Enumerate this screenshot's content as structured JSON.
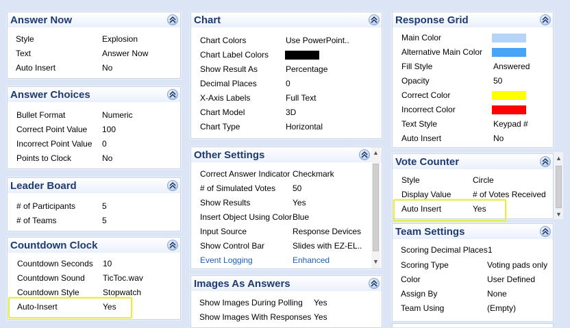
{
  "answer_now": {
    "title": "Answer Now",
    "rows": [
      {
        "label": "Style",
        "value": "Explosion"
      },
      {
        "label": "Text",
        "value": "Answer Now"
      },
      {
        "label": "Auto Insert",
        "value": "No"
      }
    ]
  },
  "answer_choices": {
    "title": "Answer Choices",
    "rows": [
      {
        "label": "Bullet Format",
        "value": "Numeric"
      },
      {
        "label": "Correct Point Value",
        "value": "100"
      },
      {
        "label": "Incorrect Point Value",
        "value": "0"
      },
      {
        "label": "Points to Clock",
        "value": "No"
      }
    ]
  },
  "leader_board": {
    "title": "Leader Board",
    "rows": [
      {
        "label": "# of Participants",
        "value": "5"
      },
      {
        "label": "# of Teams",
        "value": "5"
      }
    ]
  },
  "countdown_clock": {
    "title": "Countdown Clock",
    "rows": [
      {
        "label": "Countdown Seconds",
        "value": "10"
      },
      {
        "label": "Countdown Sound",
        "value": "TicToc.wav"
      },
      {
        "label": "Countdown Style",
        "value": "Stopwatch"
      },
      {
        "label": "Auto-Insert",
        "value": "Yes"
      }
    ]
  },
  "chart": {
    "title": "Chart",
    "rows": [
      {
        "label": "Chart Colors",
        "value": "Use PowerPoint.."
      },
      {
        "label": "Chart Label Colors",
        "value": ""
      },
      {
        "label": "Show Result As",
        "value": "Percentage"
      },
      {
        "label": "Decimal Places",
        "value": "0"
      },
      {
        "label": "X-Axis Labels",
        "value": "Full Text"
      },
      {
        "label": "Chart Model",
        "value": "3D"
      },
      {
        "label": "Chart Type",
        "value": "Horizontal"
      }
    ],
    "label_color": "#000000"
  },
  "other_settings": {
    "title": "Other Settings",
    "rows": [
      {
        "label": "Correct Answer Indicator",
        "value": "Checkmark"
      },
      {
        "label": "# of Simulated Votes",
        "value": "50"
      },
      {
        "label": "Show Results",
        "value": "Yes"
      },
      {
        "label": "Insert Object Using Color",
        "value": "Blue"
      },
      {
        "label": "Input Source",
        "value": "Response Devices"
      },
      {
        "label": "Show Control Bar",
        "value": "Slides with EZ-EL.."
      },
      {
        "label": "Event Logging",
        "value": "Enhanced"
      }
    ]
  },
  "images_as_answers": {
    "title": "Images As Answers",
    "rows": [
      {
        "label": "Show Images During Polling",
        "value": "Yes"
      },
      {
        "label": "Show Images With Responses",
        "value": "Yes"
      }
    ]
  },
  "response_grid": {
    "title": "Response Grid",
    "rows": [
      {
        "label": "Main Color",
        "value": ""
      },
      {
        "label": "Alternative Main Color",
        "value": ""
      },
      {
        "label": "Fill Style",
        "value": "Answered"
      },
      {
        "label": "Opacity",
        "value": "50"
      },
      {
        "label": "Correct Color",
        "value": ""
      },
      {
        "label": "Incorrect Color",
        "value": ""
      },
      {
        "label": "Text Style",
        "value": "Keypad #"
      },
      {
        "label": "Auto Insert",
        "value": "No"
      }
    ],
    "colors": {
      "main": "#b5d4f8",
      "alternative_main": "#4aa3f5",
      "correct": "#ffff00",
      "incorrect": "#ff0000"
    }
  },
  "vote_counter": {
    "title": "Vote Counter",
    "rows": [
      {
        "label": "Style",
        "value": "Circle"
      },
      {
        "label": "Display Value",
        "value": "# of Votes Received"
      },
      {
        "label": "Auto Insert",
        "value": "Yes"
      }
    ]
  },
  "team_settings": {
    "title": "Team Settings",
    "rows": [
      {
        "label": "Scoring Decimal Places",
        "value": "1"
      },
      {
        "label": "Scoring Type",
        "value": "Voting pads only"
      },
      {
        "label": "Color",
        "value": "User Defined"
      },
      {
        "label": "Assign By",
        "value": "None"
      },
      {
        "label": "Team Using",
        "value": "(Empty)"
      }
    ]
  },
  "colors": {
    "background": "#dbe5f5",
    "title": "#1d3a73",
    "highlight": "#e6ea52",
    "link": "#1d5fb8"
  }
}
